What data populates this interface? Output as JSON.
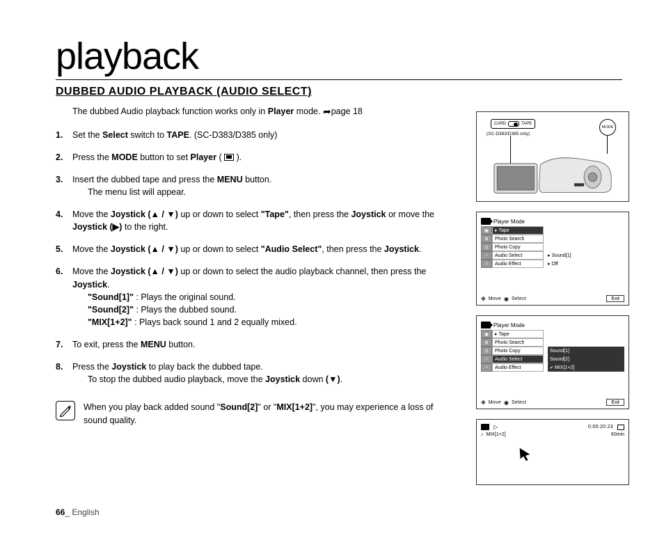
{
  "page_title": "playback",
  "section_title": "DUBBED AUDIO PLAYBACK (AUDIO SELECT)",
  "intro_pre": "The dubbed Audio playback function works only in ",
  "intro_bold": "Player",
  "intro_post": " mode. ",
  "intro_ref": "page 18",
  "steps": {
    "s1": {
      "num": "1.",
      "a": "Set the ",
      "b1": "Select",
      "c": " switch to ",
      "b2": "TAPE",
      "d": ". (SC-D383/D385 only)"
    },
    "s2": {
      "num": "2.",
      "a": "Press the ",
      "b1": "MODE",
      "c": " button to set ",
      "b2": "Player",
      "d": " ( ",
      "icon": "▣",
      "e": " )."
    },
    "s3": {
      "num": "3.",
      "a": "Insert the dubbed tape and press the ",
      "b1": "MENU",
      "c": " button.",
      "sub": "The menu list will appear."
    },
    "s4": {
      "num": "4.",
      "a": "Move the ",
      "b1": "Joystick (▲ / ▼)",
      "c": " up or down to select ",
      "q": "\"Tape\"",
      "d": ", then press the ",
      "b2": "Joystick",
      "e": " or move the ",
      "b3": "Joystick (▶)",
      "f": " to the right."
    },
    "s5": {
      "num": "5.",
      "a": "Move the ",
      "b1": "Joystick (▲ / ▼)",
      "c": " up or down to select ",
      "q": "\"Audio Select\"",
      "d": ", then press the ",
      "b2": "Joystick",
      "e": "."
    },
    "s6": {
      "num": "6.",
      "a": "Move the ",
      "b1": "Joystick (▲ / ▼)",
      "c": " up or down to select the audio playback channel, then press the ",
      "b2": "Joystick",
      "d": ".",
      "opt1": {
        "label": "\"Sound[1]\"",
        "desc": " : Plays the original sound."
      },
      "opt2": {
        "label": "\"Sound[2]\"",
        "desc": " : Plays the dubbed sound."
      },
      "opt3": {
        "label": "\"MIX[1+2]\"",
        "desc": " : Plays back sound 1 and 2 equally mixed."
      }
    },
    "s7": {
      "num": "7.",
      "a": "To exit, press the ",
      "b1": "MENU",
      "c": " button."
    },
    "s8": {
      "num": "8.",
      "a": "Press the ",
      "b1": "Joystick",
      "c": " to play back the dubbed tape.",
      "sub_a": "To stop the dubbed audio playback, move the ",
      "sub_b": "Joystick",
      "sub_c": " down ",
      "sub_d": "(▼)",
      "sub_e": "."
    }
  },
  "note": {
    "a": "When you play back added sound \"",
    "b1": "Sound[2]",
    "c": "\" or \"",
    "b2": "MIX[1+2]",
    "d": "\", you may experience a loss of sound quality."
  },
  "footer": {
    "page": "66",
    "sep": "_ ",
    "lang": "English"
  },
  "illus": {
    "switch": {
      "left": "CARD",
      "right": "TAPE",
      "note": "(SC-D383/D385 only)"
    },
    "mode_btn": "MODE",
    "menu1": {
      "header": "Player Mode",
      "tape": "Tape",
      "items": [
        "Photo Search",
        "Photo Copy",
        "Audio Select",
        "Audio Effect"
      ],
      "opts": [
        "Sound[1]",
        "Off"
      ],
      "footer": {
        "move": "Move",
        "select": "Select",
        "exit": "Exit"
      }
    },
    "menu2": {
      "header": "Player Mode",
      "tape": "Tape",
      "items": [
        "Photo Search",
        "Photo Copy",
        "Audio Select",
        "Audio Effect"
      ],
      "opts": [
        "Sound[1]",
        "Sound[2]",
        "MIX[1+2]"
      ],
      "footer": {
        "move": "Move",
        "select": "Select",
        "exit": "Exit"
      }
    },
    "playbar": {
      "play": "▷",
      "time": "0:00:20:23",
      "mix": "MIX[1+2]",
      "min": "60min"
    }
  }
}
